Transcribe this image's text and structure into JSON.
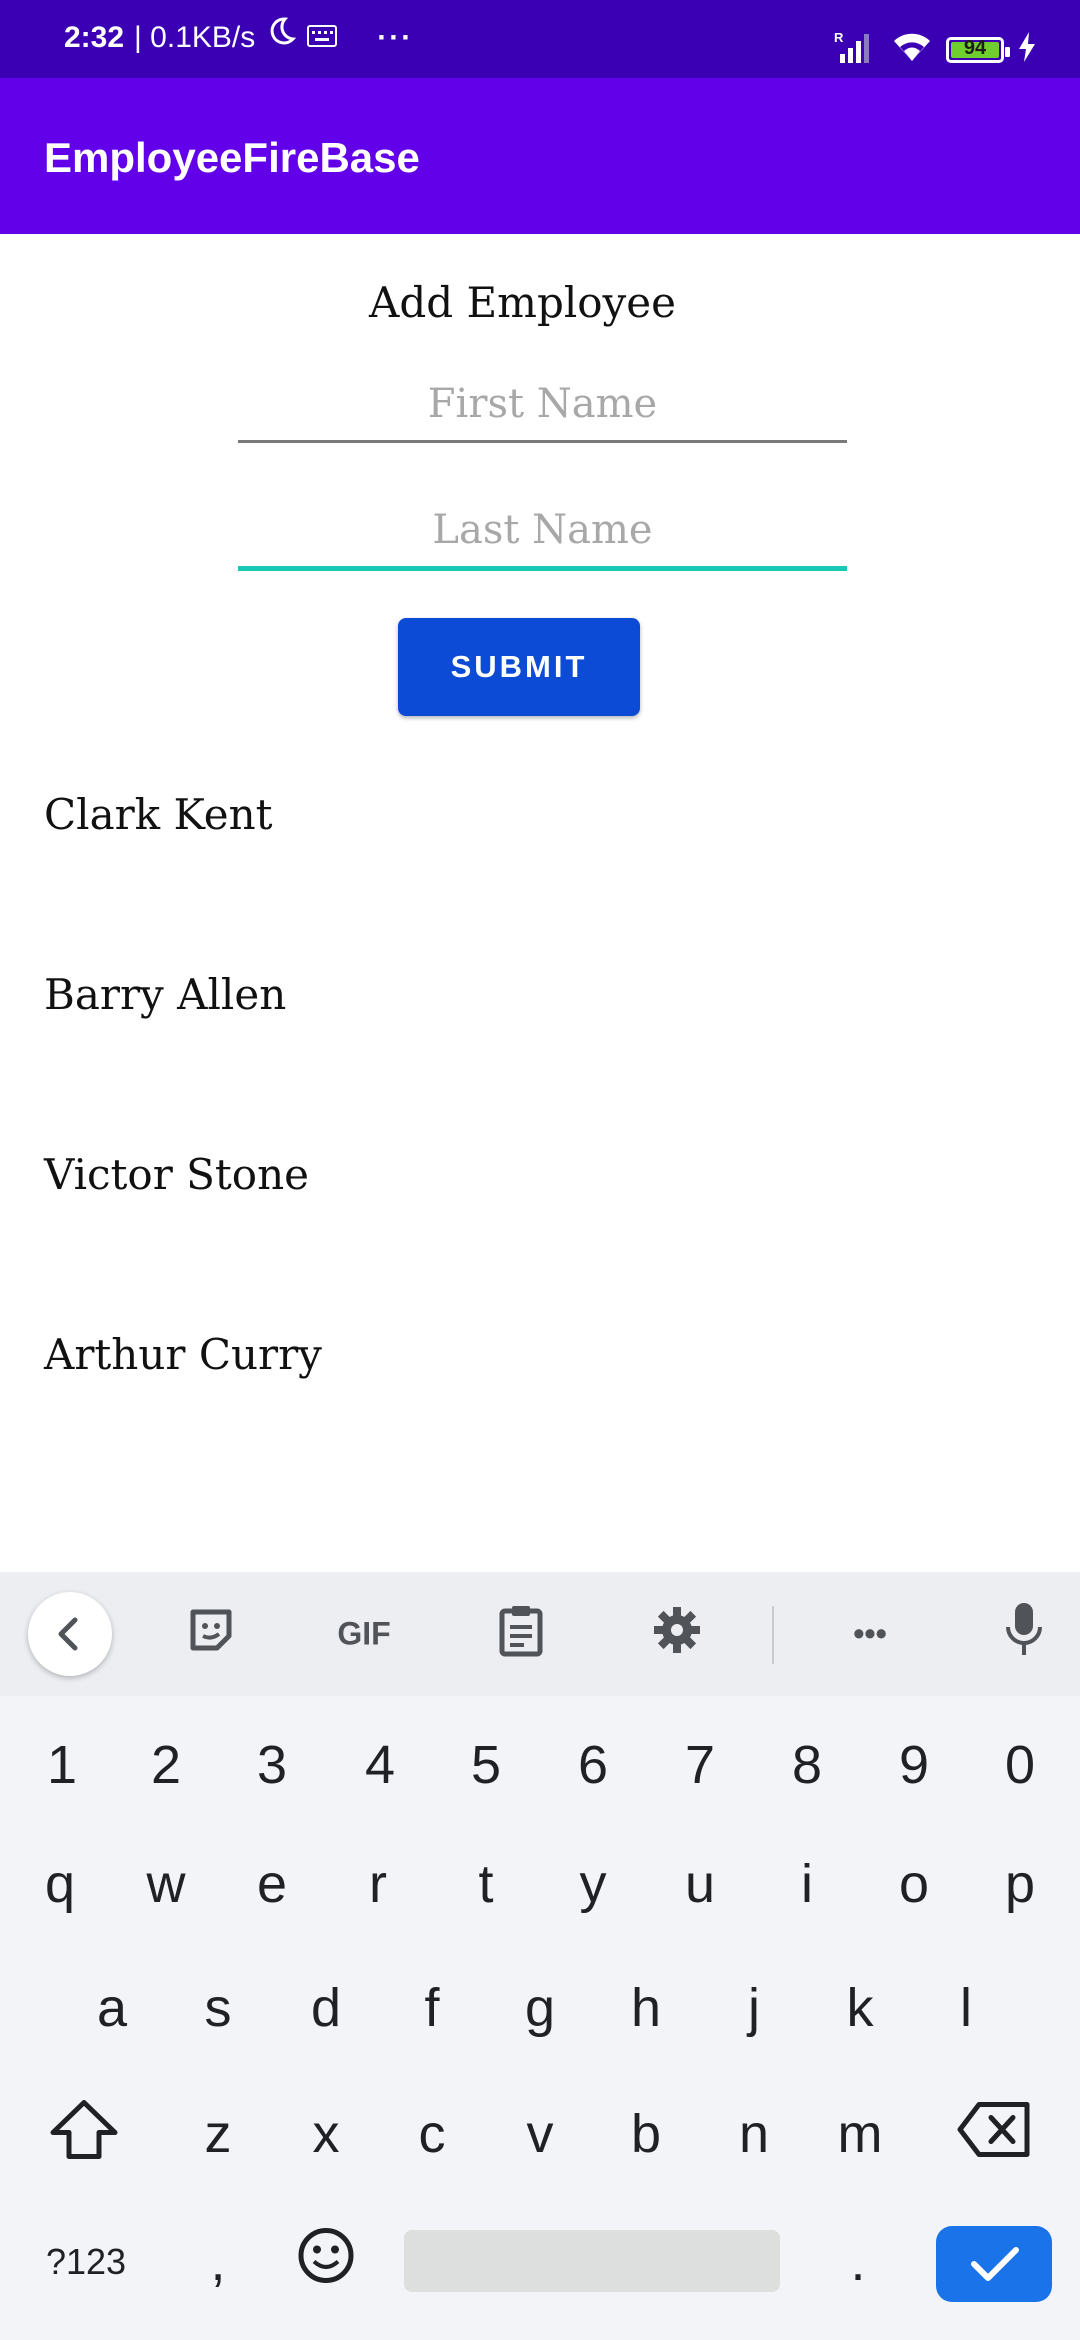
{
  "status_bar": {
    "time": "2:32",
    "network_speed": "| 0.1KB/s",
    "dots": "···",
    "battery": "94",
    "signal_label": "R"
  },
  "app_bar": {
    "title": "EmployeeFireBase"
  },
  "form": {
    "heading": "Add Employee",
    "first_name_placeholder": "First Name",
    "last_name_placeholder": "Last Name",
    "submit_label": "SUBMIT"
  },
  "employees": [
    "Clark Kent",
    "Barry Allen",
    "Victor Stone",
    "Arthur Curry"
  ],
  "keyboard": {
    "toolbar": {
      "gif_label": "GIF",
      "more_label": "•••"
    },
    "number_row": [
      "1",
      "2",
      "3",
      "4",
      "5",
      "6",
      "7",
      "8",
      "9",
      "0"
    ],
    "row1": [
      "q",
      "w",
      "e",
      "r",
      "t",
      "y",
      "u",
      "i",
      "o",
      "p"
    ],
    "row2": [
      "a",
      "s",
      "d",
      "f",
      "g",
      "h",
      "j",
      "k",
      "l"
    ],
    "row3": [
      "z",
      "x",
      "c",
      "v",
      "b",
      "n",
      "m"
    ],
    "symbols_label": "?123",
    "comma": ",",
    "period": "."
  },
  "colors": {
    "status_bar": "#3b00b3",
    "app_bar": "#6200ea",
    "submit": "#0c4bd6",
    "focus_underline": "#18c9b5",
    "enter_key": "#1a73e8"
  }
}
